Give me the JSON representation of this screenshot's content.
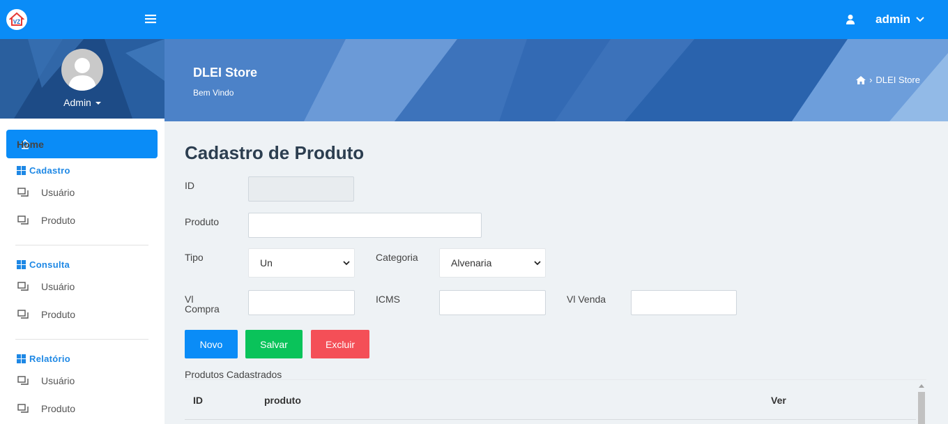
{
  "topbar": {
    "logo": "vz-store-logo",
    "menu_icon": "hamburger-icon",
    "user_icon": "user-icon",
    "user_name": "admin"
  },
  "sidebar": {
    "user_name": "Admin",
    "home_label": "Home",
    "sections": [
      {
        "title": "Cadastro",
        "items": [
          "Usuário",
          "Produto"
        ]
      },
      {
        "title": "Consulta",
        "items": [
          "Usuário",
          "Produto"
        ]
      },
      {
        "title": "Relatório",
        "items": [
          "Usuário",
          "Produto"
        ]
      }
    ]
  },
  "banner": {
    "title": "DLEI Store",
    "subtitle": "Bem Vindo",
    "breadcrumb": "DLEI Store"
  },
  "form": {
    "title": "Cadastro de Produto",
    "id_label": "ID",
    "id_value": "",
    "produto_label": "Produto",
    "produto_value": "",
    "tipo_label": "Tipo",
    "tipo_value": "Un",
    "categoria_label": "Categoria",
    "categoria_value": "Alvenaria",
    "vl_compra_label_1": "Vl",
    "vl_compra_label_2": "Compra",
    "vl_compra_value": "",
    "icms_label": "ICMS",
    "icms_value": "",
    "vl_venda_label": "Vl Venda",
    "vl_venda_value": ""
  },
  "buttons": {
    "novo": "Novo",
    "salvar": "Salvar",
    "excluir": "Excluir"
  },
  "table": {
    "caption": "Produtos Cadastrados",
    "columns": [
      "ID",
      "produto",
      "Ver"
    ]
  },
  "colors": {
    "primary": "#0a8cf7",
    "success": "#0ac35a",
    "danger": "#f44f57",
    "section_title": "#1e88e5"
  }
}
